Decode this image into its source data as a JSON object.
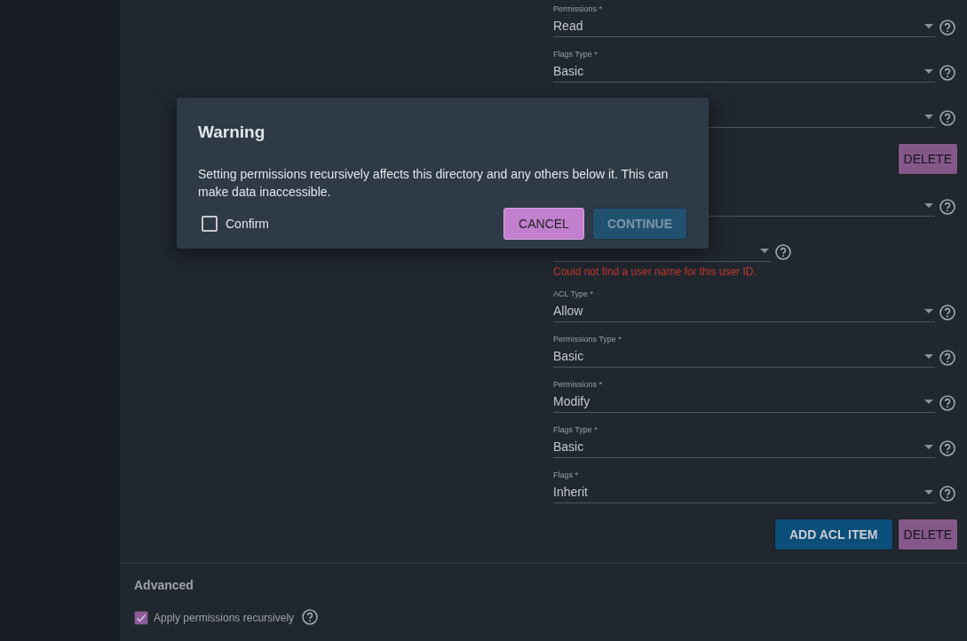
{
  "acl_items": [
    {
      "kind": "select",
      "label": "Permissions *",
      "value": "Read"
    },
    {
      "kind": "select",
      "label": "Flags Type *",
      "value": "Basic"
    },
    {
      "kind": "select"
    },
    {
      "kind": "actions",
      "buttons": [
        {
          "kind": "delete",
          "label": "DELETE"
        }
      ]
    },
    {
      "kind": "select"
    },
    {
      "kind": "user",
      "error": "Could not find a user name for this user ID."
    },
    {
      "kind": "select",
      "label": "ACL Type *",
      "value": "Allow"
    },
    {
      "kind": "select",
      "label": "Permissions Type *",
      "value": "Basic"
    },
    {
      "kind": "select",
      "label": "Permissions *",
      "value": "Modify"
    },
    {
      "kind": "select",
      "label": "Flags Type *",
      "value": "Basic"
    },
    {
      "kind": "select",
      "label": "Flags *",
      "value": "Inherit"
    },
    {
      "kind": "actions",
      "buttons": [
        {
          "kind": "add",
          "label": "ADD ACL ITEM"
        },
        {
          "kind": "delete",
          "label": "DELETE"
        }
      ]
    }
  ],
  "advanced": {
    "title": "Advanced",
    "recursive": {
      "label": "Apply permissions recursively",
      "checked": true
    }
  },
  "dialog": {
    "title": "Warning",
    "message": "Setting permissions recursively affects this directory and any others below it. This can make data inaccessible.",
    "confirm": {
      "label": "Confirm",
      "checked": false
    },
    "buttons": [
      {
        "kind": "cancel",
        "label": "CANCEL",
        "disabled": false
      },
      {
        "kind": "continue",
        "label": "CONTINUE",
        "disabled": true
      }
    ]
  }
}
